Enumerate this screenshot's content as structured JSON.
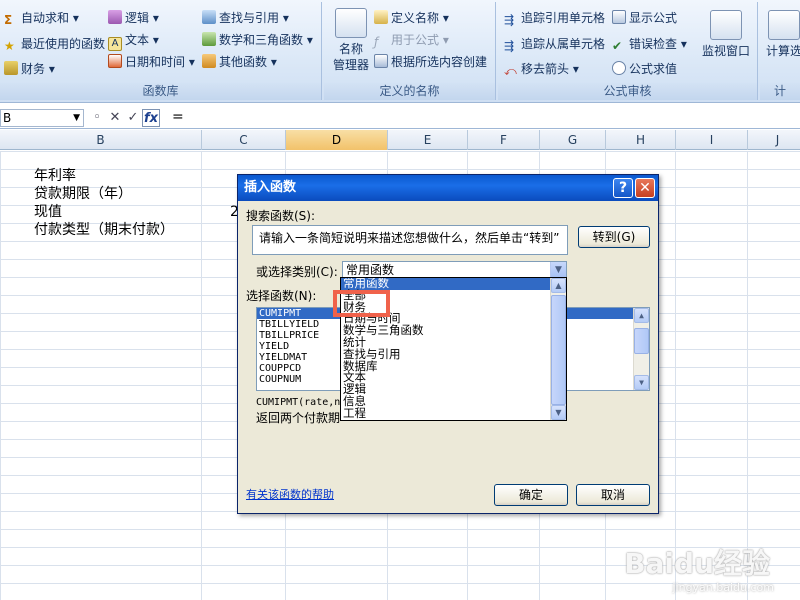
{
  "ribbon": {
    "library": {
      "label": "函数库",
      "autosum": "自动求和",
      "recent": "最近使用的函数",
      "financial": "财务",
      "logical": "逻辑",
      "text": "文本",
      "datetime": "日期和时间",
      "lookup": "查找与引用",
      "math": "数学和三角函数",
      "more": "其他函数"
    },
    "names": {
      "label": "定义的名称",
      "manager_line1": "名称",
      "manager_line2": "管理器",
      "define": "定义名称",
      "use_in_formula": "用于公式",
      "create_from_selection": "根据所选内容创建"
    },
    "audit": {
      "label": "公式审核",
      "trace_precedents": "追踪引用单元格",
      "trace_dependents": "追踪从属单元格",
      "remove_arrows": "移去箭头",
      "show_formulas": "显示公式",
      "error_checking": "错误检查",
      "evaluate": "公式求值",
      "watch_window": "监视窗口"
    },
    "calc": {
      "label": "计",
      "options": "计算选"
    }
  },
  "formula_bar": {
    "name_box": "B",
    "cancel": "✕",
    "enter": "✓",
    "fx": "fx",
    "equals": "="
  },
  "columns": [
    "B",
    "C",
    "D",
    "E",
    "F",
    "G",
    "H",
    "I",
    "J"
  ],
  "cells": {
    "b1": "年利率",
    "b2": "贷款期限（年）",
    "b3": "现值",
    "b4": "付款类型（期末付款）",
    "c3": "2"
  },
  "dialog": {
    "title": "插入函数",
    "help_btn": "?",
    "close_btn": "✕",
    "search_label": "搜索函数(S):",
    "search_text": "请输入一条简短说明来描述您想做什么，然后单击“转到”",
    "go_btn": "转到(G)",
    "category_label": "或选择类别(C):",
    "category_value": "常用函数",
    "select_label": "选择函数(N):",
    "functions": [
      "CUMIPMT",
      "TBILLYIELD",
      "TBILLPRICE",
      "YIELD",
      "YIELDMAT",
      "COUPPCD",
      "COUPNUM"
    ],
    "syntax": "CUMIPMT(rate,nper",
    "description": "返回两个付款期",
    "help_link": "有关该函数的帮助",
    "ok_btn": "确定",
    "cancel_btn": "取消"
  },
  "category_list": [
    "常用函数",
    "全部",
    "财务",
    "日期与时间",
    "数学与三角函数",
    "统计",
    "查找与引用",
    "数据库",
    "文本",
    "逻辑",
    "信息",
    "工程"
  ],
  "watermark": {
    "brand": "Baidu经验",
    "url": "jingyan.baidu.com"
  },
  "colors": {
    "ribbon_bg": "#dbe8f7",
    "dialog_title": "#0a58ce",
    "selection": "#316ac5",
    "highlight_box": "#f0624b"
  }
}
